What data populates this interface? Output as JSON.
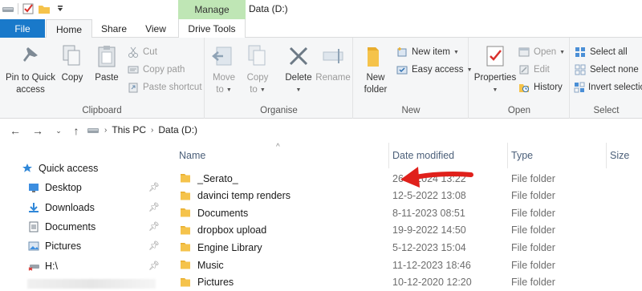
{
  "titlebar": {
    "context_tab": "Manage",
    "window_title": "Data (D:)"
  },
  "tabs": {
    "file": "File",
    "home": "Home",
    "share": "Share",
    "view": "View",
    "drive_tools": "Drive Tools"
  },
  "ribbon": {
    "clipboard": {
      "label": "Clipboard",
      "pin": "Pin to Quick access",
      "pin_l1": "Pin to Quick",
      "pin_l2": "access",
      "copy": "Copy",
      "paste": "Paste",
      "cut": "Cut",
      "copy_path": "Copy path",
      "paste_shortcut": "Paste shortcut"
    },
    "organise": {
      "label": "Organise",
      "move_l1": "Move",
      "move_l2": "to",
      "copy_l1": "Copy",
      "copy_l2": "to",
      "delete": "Delete",
      "rename": "Rename"
    },
    "new": {
      "label": "New",
      "folder_l1": "New",
      "folder_l2": "folder",
      "new_item": "New item",
      "easy_access": "Easy access"
    },
    "open": {
      "label": "Open",
      "properties": "Properties",
      "open": "Open",
      "edit": "Edit",
      "history": "History"
    },
    "select": {
      "label": "Select",
      "select_all": "Select all",
      "select_none": "Select none",
      "invert": "Invert selection"
    }
  },
  "address": {
    "crumbs": [
      "This PC",
      "Data (D:)"
    ]
  },
  "navpane": {
    "items": [
      {
        "label": "Quick access",
        "icon": "star-icon",
        "pinned": false
      },
      {
        "label": "Desktop",
        "icon": "desktop-icon",
        "pinned": true
      },
      {
        "label": "Downloads",
        "icon": "downloads-icon",
        "pinned": true
      },
      {
        "label": "Documents",
        "icon": "documents-icon",
        "pinned": true
      },
      {
        "label": "Pictures",
        "icon": "pictures-icon",
        "pinned": true
      },
      {
        "label": "H:\\",
        "icon": "network-drive-icon",
        "pinned": true
      }
    ]
  },
  "columns": {
    "name": "Name",
    "date": "Date modified",
    "type": "Type",
    "size": "Size"
  },
  "files": [
    {
      "name": "_Serato_",
      "date": "26-1-2024 13:22",
      "type": "File folder"
    },
    {
      "name": "davinci temp renders",
      "date": "12-5-2022 13:08",
      "type": "File folder"
    },
    {
      "name": "Documents",
      "date": "8-11-2023 08:51",
      "type": "File folder"
    },
    {
      "name": "dropbox upload",
      "date": "19-9-2022 14:50",
      "type": "File folder"
    },
    {
      "name": "Engine Library",
      "date": "5-12-2023 15:04",
      "type": "File folder"
    },
    {
      "name": "Music",
      "date": "11-12-2023 18:46",
      "type": "File folder"
    },
    {
      "name": "Pictures",
      "date": "10-12-2020 12:20",
      "type": "File folder"
    }
  ],
  "colors": {
    "file_tab": "#1979ca",
    "context_tab": "#bfe6b5",
    "folder": "#f5c34b",
    "annotation": "#e0201b"
  }
}
